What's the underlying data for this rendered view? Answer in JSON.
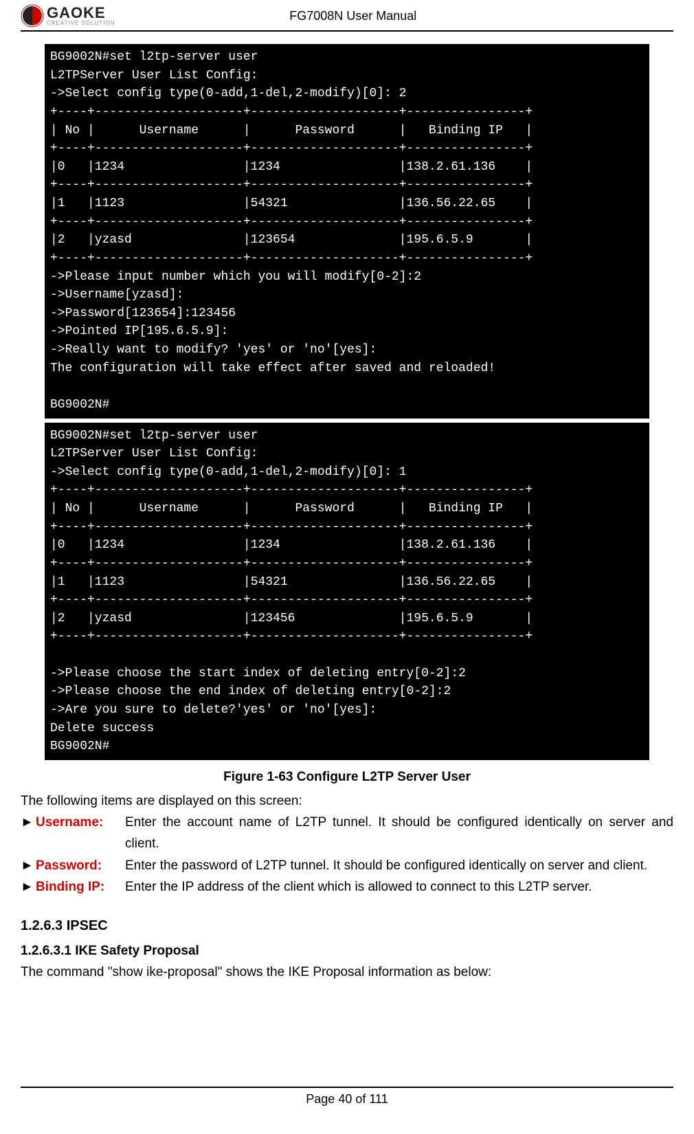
{
  "header": {
    "brand_name": "GAOKE",
    "brand_sub": "CREATIVE SOLUTION",
    "title": "FG7008N User Manual"
  },
  "terminals": {
    "t1_lines": [
      "BG9002N#set l2tp-server user",
      "L2TPServer User List Config:",
      "->Select config type(0-add,1-del,2-modify)[0]: 2",
      "+----+--------------------+--------------------+----------------+",
      "| No |      Username      |      Password      |   Binding IP   |",
      "+----+--------------------+--------------------+----------------+",
      "|0   |1234                |1234                |138.2.61.136    |",
      "+----+--------------------+--------------------+----------------+",
      "|1   |1123                |54321               |136.56.22.65    |",
      "+----+--------------------+--------------------+----------------+",
      "|2   |yzasd               |123654              |195.6.5.9       |",
      "+----+--------------------+--------------------+----------------+",
      "->Please input number which you will modify[0-2]:2",
      "->Username[yzasd]:",
      "->Password[123654]:123456",
      "->Pointed IP[195.6.5.9]:",
      "->Really want to modify? 'yes' or 'no'[yes]:",
      "The configuration will take effect after saved and reloaded!",
      "",
      "BG9002N#"
    ],
    "t2_lines": [
      "BG9002N#set l2tp-server user",
      "L2TPServer User List Config:",
      "->Select config type(0-add,1-del,2-modify)[0]: 1",
      "+----+--------------------+--------------------+----------------+",
      "| No |      Username      |      Password      |   Binding IP   |",
      "+----+--------------------+--------------------+----------------+",
      "|0   |1234                |1234                |138.2.61.136    |",
      "+----+--------------------+--------------------+----------------+",
      "|1   |1123                |54321               |136.56.22.65    |",
      "+----+--------------------+--------------------+----------------+",
      "|2   |yzasd               |123456              |195.6.5.9       |",
      "+----+--------------------+--------------------+----------------+",
      "",
      "->Please choose the start index of deleting entry[0-2]:2",
      "->Please choose the end index of deleting entry[0-2]:2",
      "->Are you sure to delete?'yes' or 'no'[yes]:",
      "Delete success",
      "BG9002N#"
    ]
  },
  "caption": "Figure 1-63    Configure L2TP Server User",
  "intro": "The following items are displayed on this screen:",
  "items": [
    {
      "marker": "►",
      "label": "Username:",
      "desc": "Enter the account name of L2TP tunnel. It should be configured identically on server and client."
    },
    {
      "marker": "►",
      "label": "Password:",
      "desc": "Enter the password of L2TP tunnel. It should be configured identically on server and client."
    },
    {
      "marker": "►",
      "label": "Binding IP:",
      "desc": "Enter the IP address of the client which is allowed to connect to this L2TP server."
    }
  ],
  "section_heading": "1.2.6.3    IPSEC",
  "sub_heading": "1.2.6.3.1    IKE Safety Proposal",
  "sub_text": "The command \"show ike-proposal\" shows the IKE Proposal information as below:",
  "footer": "Page 40 of 111"
}
